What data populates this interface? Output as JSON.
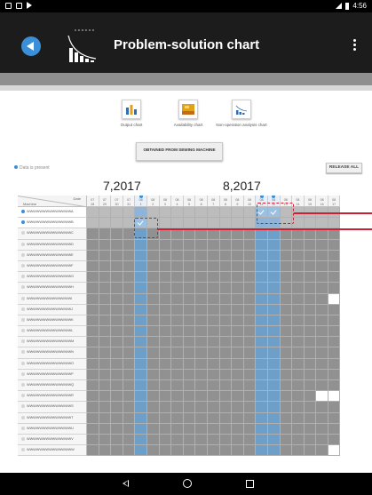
{
  "app": {
    "title": "Problem-solution chart"
  },
  "charts": [
    {
      "label": "Output chart",
      "icon": "bar-chart-icon",
      "color": "#2f6fb5"
    },
    {
      "label": "Availability chart",
      "icon": "availability-chart-icon",
      "color": "#e0a21b"
    },
    {
      "label": "Non-operation analysis chart",
      "icon": "pareto-chart-icon",
      "color": "#2f6fb5"
    }
  ],
  "actions": {
    "obtain_label": "OBTAINED FROM SEWING MACHINE",
    "release_all_label": "RELEASE ALL",
    "legend_label": "Data is present"
  },
  "months": [
    "7,2017",
    "8,2017"
  ],
  "grid": {
    "header_date": "Date",
    "header_machine": "Machine",
    "columns": [
      {
        "m": "07",
        "d": "28"
      },
      {
        "m": "07",
        "d": "29"
      },
      {
        "m": "07",
        "d": "30"
      },
      {
        "m": "07",
        "d": "31"
      },
      {
        "m": "08",
        "d": "1"
      },
      {
        "m": "08",
        "d": "2"
      },
      {
        "m": "08",
        "d": "3"
      },
      {
        "m": "08",
        "d": "4"
      },
      {
        "m": "08",
        "d": "5"
      },
      {
        "m": "08",
        "d": "6"
      },
      {
        "m": "08",
        "d": "7"
      },
      {
        "m": "08",
        "d": "8"
      },
      {
        "m": "08",
        "d": "9"
      },
      {
        "m": "08",
        "d": "10"
      },
      {
        "m": "08",
        "d": "11"
      },
      {
        "m": "08",
        "d": "12"
      },
      {
        "m": "08",
        "d": "13"
      },
      {
        "m": "08",
        "d": "14"
      },
      {
        "m": "08",
        "d": "15"
      },
      {
        "m": "08",
        "d": "16"
      },
      {
        "m": "08",
        "d": "17"
      }
    ],
    "data_columns": [
      4,
      14,
      15
    ],
    "rows": [
      {
        "name": "WWWWWWWWWWWWWWA",
        "active": true
      },
      {
        "name": "WWWWWWWWWWWWWWB",
        "active": true
      },
      {
        "name": "WWWWWWWWWWWWWWC",
        "active": false
      },
      {
        "name": "WWWWWWWWWWWWWWD",
        "active": false
      },
      {
        "name": "WWWWWWWWWWWWWWE",
        "active": false
      },
      {
        "name": "WWWWWWWWWWWWWWF",
        "active": false
      },
      {
        "name": "WWWWWWWWWWWWWWG",
        "active": false
      },
      {
        "name": "WWWWWWWWWWWWWWH",
        "active": false
      },
      {
        "name": "WWWWWWWWWWWWWWI",
        "active": false
      },
      {
        "name": "WWWWWWWWWWWWWWJ",
        "active": false
      },
      {
        "name": "WWWWWWWWWWWWWWK",
        "active": false
      },
      {
        "name": "WWWWWWWWWWWWWWL",
        "active": false
      },
      {
        "name": "WWWWWWWWWWWWWWM",
        "active": false
      },
      {
        "name": "WWWWWWWWWWWWWWN",
        "active": false
      },
      {
        "name": "WWWWWWWWWWWWWWO",
        "active": false
      },
      {
        "name": "WWWWWWWWWWWWWWP",
        "active": false
      },
      {
        "name": "WWWWWWWWWWWWWWQ",
        "active": false
      },
      {
        "name": "WWWWWWWWWWWWWWR",
        "active": false
      },
      {
        "name": "WWWWWWWWWWWWWWS",
        "active": false
      },
      {
        "name": "WWWWWWWWWWWWWWT",
        "active": false
      },
      {
        "name": "WWWWWWWWWWWWWWU",
        "active": false
      },
      {
        "name": "WWWWWWWWWWWWWWV",
        "active": false
      },
      {
        "name": "WWWWWWWWWWWWWWW",
        "active": false
      }
    ],
    "checked": [
      [
        0,
        14
      ],
      [
        0,
        15
      ],
      [
        1,
        4
      ]
    ],
    "white": [
      [
        8,
        20
      ],
      [
        17,
        19
      ],
      [
        17,
        20
      ],
      [
        22,
        20
      ]
    ]
  },
  "colors": {
    "accent": "#3a8fd8",
    "highlight": "#d01f34"
  }
}
